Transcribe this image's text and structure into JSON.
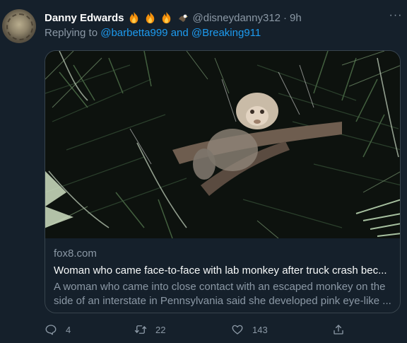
{
  "tweet": {
    "author_name": "Danny Edwards",
    "handle": "@disneydanny312",
    "separator": "·",
    "time": "9h",
    "replying_prefix": "Replying to",
    "reply_to_1": "@barbetta999",
    "reply_conjunction": "and",
    "reply_to_2": "@Breaking911",
    "emojis": [
      "flame-emoji",
      "flame-emoji",
      "flame-emoji",
      "eagle-emoji"
    ],
    "more_label": "···"
  },
  "card": {
    "domain": "fox8.com",
    "title": "Woman who came face-to-face with lab monkey after truck crash bec...",
    "description": "A woman who came into close contact with an escaped monkey on the side of an interstate in Pennsylvania said she developed pink eye-like ...",
    "image_icon": "monkey-in-pine-tree-photo"
  },
  "actions": {
    "reply_count": "4",
    "retweet_count": "22",
    "like_count": "143"
  },
  "colors": {
    "background": "#15202b",
    "link": "#1d9bf0",
    "muted": "#8b98a5",
    "border": "#38444d"
  }
}
